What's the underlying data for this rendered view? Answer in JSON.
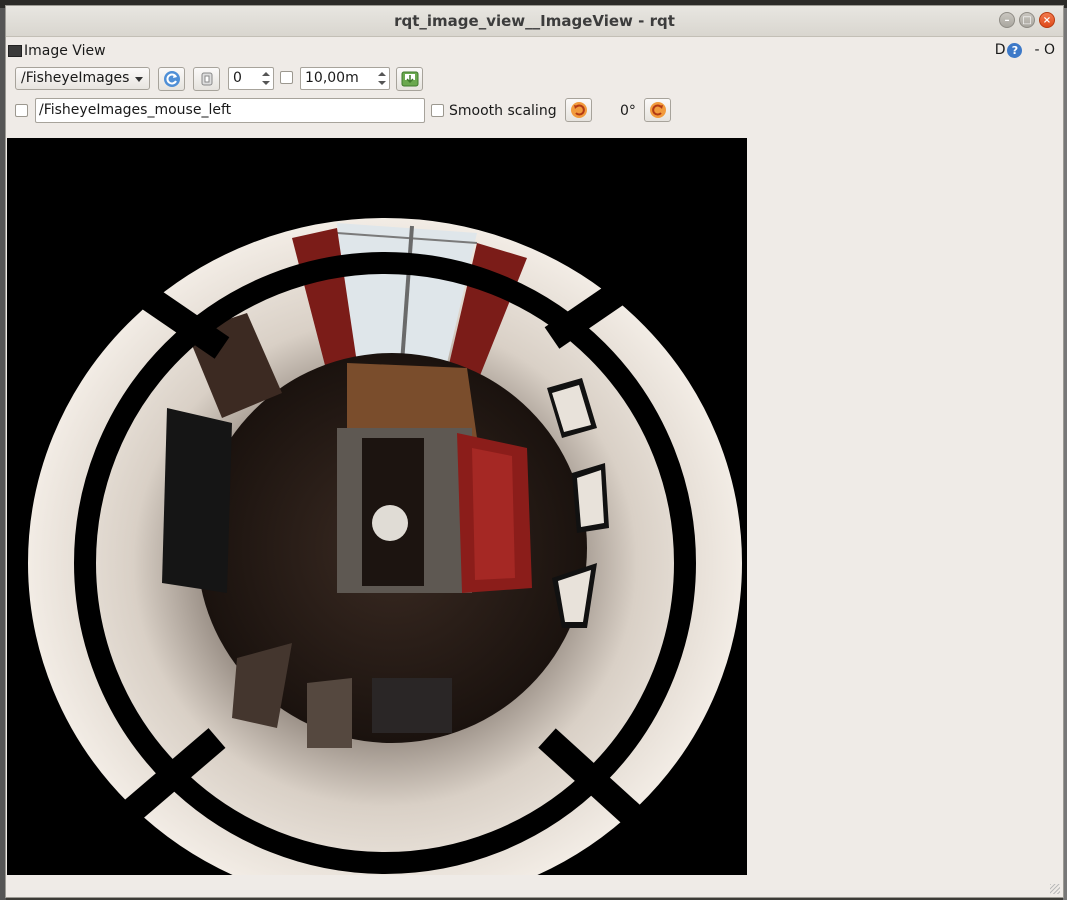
{
  "window": {
    "title": "rqt_image_view__ImageView - rqt"
  },
  "dock": {
    "title": "Image View",
    "right_letter": "D",
    "help_glyph": "?",
    "right_text": "- O"
  },
  "toolbar": {
    "topic": "/FisheyeImages",
    "refresh_icon": "refresh-icon",
    "zoom_value": "0",
    "max_range": "10,00m",
    "save_icon": "save-image-icon"
  },
  "toolbar2": {
    "mouse_topic": "/FisheyeImages_mouse_left",
    "smooth_scaling_label": "Smooth scaling",
    "rotation_label": "0°",
    "rotate_left_icon": "rotate-left-icon",
    "rotate_right_icon": "rotate-right-icon"
  },
  "image": {
    "description_icon": "fisheye-room-image"
  }
}
